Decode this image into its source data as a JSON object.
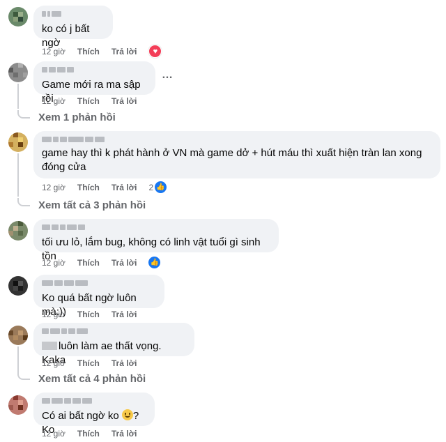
{
  "comments": [
    {
      "text": "ko có j bất ngờ",
      "time": "12 giờ",
      "like": "Thích",
      "reply": "Trả lời",
      "reaction": "heart"
    },
    {
      "text": "Game mới ra ma sập rồi",
      "time": "12 giờ",
      "like": "Thích",
      "reply": "Trả lời",
      "more": "…",
      "replies_link": "Xem 1 phản hồi"
    },
    {
      "text": "game hay thì k phát hành ở VN mà game dở + hút máu thì xuất hiện tràn lan xong\nđóng cửa",
      "time": "12 giờ",
      "like": "Thích",
      "reply": "Trả lời",
      "reaction_count": "2",
      "reaction": "like",
      "replies_link": "Xem tất cả 3 phản hồi"
    },
    {
      "text": "tối ưu lỏ, lắm bug, không có linh vật tuổi gì sinh tồn",
      "time": "12 giờ",
      "like": "Thích",
      "reply": "Trả lời",
      "reaction": "like"
    },
    {
      "text": "Ko quá bất ngờ luôn mà:))",
      "time": "12 giờ",
      "like": "Thích",
      "reply": "Trả lời"
    },
    {
      "text": "luôn làm ae thất vọng. Kaka",
      "time": "12 giờ",
      "like": "Thích",
      "reply": "Trả lời",
      "replies_link": "Xem tất cả 4 phản hồi"
    },
    {
      "text_before": "Có ai bất ngờ ko ",
      "text_after": "? Ko",
      "emoji": "slightly-smiling-face",
      "time": "12 giờ",
      "like": "Thích",
      "reply": "Trả lời"
    }
  ],
  "colors": {
    "bubble": "#f0f2f5",
    "meta_text": "#65676b",
    "like_blue": "#1877f2",
    "heart_red": "#f33e58"
  }
}
